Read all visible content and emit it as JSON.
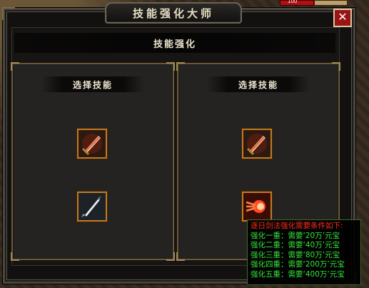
{
  "window": {
    "title": "技能强化大师",
    "close_label": "✕"
  },
  "hud": {
    "hp_text": "100"
  },
  "section": {
    "title": "技能强化"
  },
  "left_column": {
    "header": "选择技能",
    "skills": [
      {
        "icon": "sword-slash-skill-icon"
      },
      {
        "icon": "dagger-thrust-skill-icon"
      }
    ]
  },
  "right_column": {
    "header": "选择技能",
    "skills": [
      {
        "icon": "sword-slash-skill-icon"
      },
      {
        "icon": "fire-orb-skill-icon"
      }
    ]
  },
  "tooltip": {
    "title": "逐日剑法强化需要条件如下:",
    "lines": [
      "强化一重：需要‘20万’元宝",
      "强化二重：需要‘40万’元宝",
      "强化三重：需要‘80万’元宝",
      "强化四重：需要‘200万’元宝",
      "强化五重：需要‘400万’元宝"
    ]
  },
  "colors": {
    "tooltip_title": "#ff2a1a",
    "tooltip_text": "#35e43a",
    "slot_border": "#c27a20",
    "close_button": "#9a1414"
  }
}
